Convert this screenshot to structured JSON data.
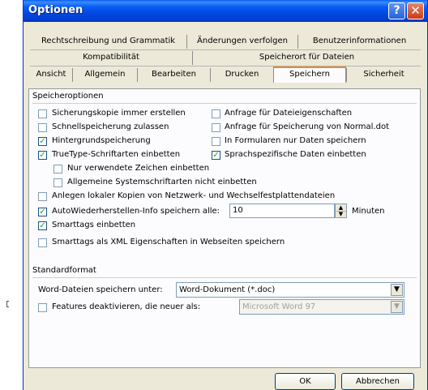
{
  "title": "Optionen",
  "title_buttons": {
    "help": "?",
    "close": "✕"
  },
  "tabs_row1": [
    "Rechtschreibung und Grammatik",
    "Änderungen verfolgen",
    "Benutzerinformationen"
  ],
  "tabs_row2": [
    "Kompatibilität",
    "Speicherort für Dateien"
  ],
  "tabs_row3": [
    "Ansicht",
    "Allgemein",
    "Bearbeiten",
    "Drucken",
    "Speichern",
    "Sicherheit"
  ],
  "active_tab": "Speichern",
  "save_options": {
    "group_label": "Speicheroptionen",
    "left": [
      {
        "label": "Sicherungskopie immer erstellen",
        "checked": false
      },
      {
        "label": "Schnellspeicherung zulassen",
        "checked": false
      },
      {
        "label": "Hintergrundspeicherung",
        "checked": true
      },
      {
        "label": "TrueType-Schriftarten einbetten",
        "checked": true
      }
    ],
    "right": [
      {
        "label": "Anfrage für Dateieigenschaften",
        "checked": false
      },
      {
        "label": "Anfrage für Speicherung von Normal.dot",
        "checked": false
      },
      {
        "label": "In Formularen nur Daten speichern",
        "checked": false
      },
      {
        "label": "Sprachspezifische Daten einbetten",
        "checked": true
      }
    ],
    "sub": [
      {
        "label": "Nur verwendete Zeichen einbetten",
        "checked": false
      },
      {
        "label": "Allgemeine Systemschriftarten nicht einbetten",
        "checked": false
      }
    ],
    "local_copies": {
      "label": "Anlegen lokaler Kopien von Netzwerk- und Wechselfestplattendateien",
      "checked": false
    },
    "autorecover": {
      "label": "AutoWiederherstellen-Info speichern alle:",
      "checked": true,
      "value": "10",
      "unit": "Minuten"
    },
    "smarttags": {
      "label": "Smarttags einbetten",
      "checked": true
    },
    "smarttags_xml": {
      "label": "Smarttags als XML Eigenschaften in Webseiten speichern",
      "checked": false
    }
  },
  "standard_format": {
    "group_label": "Standardformat",
    "save_as_label": "Word-Dateien speichern unter:",
    "save_as_value": "Word-Dokument (*.doc)",
    "disable_features": {
      "label": "Features deaktivieren, die neuer als:",
      "checked": false
    },
    "version_value": "Microsoft Word 97"
  },
  "buttons": {
    "ok": "OK",
    "cancel": "Abbrechen"
  },
  "colors": {
    "titlebar": "#0a5ef6",
    "dialog_bg": "#ece9d8",
    "panel_bg": "#fcfcfe",
    "check": "#21a121",
    "active_tab_accent": "#e68b2c"
  }
}
